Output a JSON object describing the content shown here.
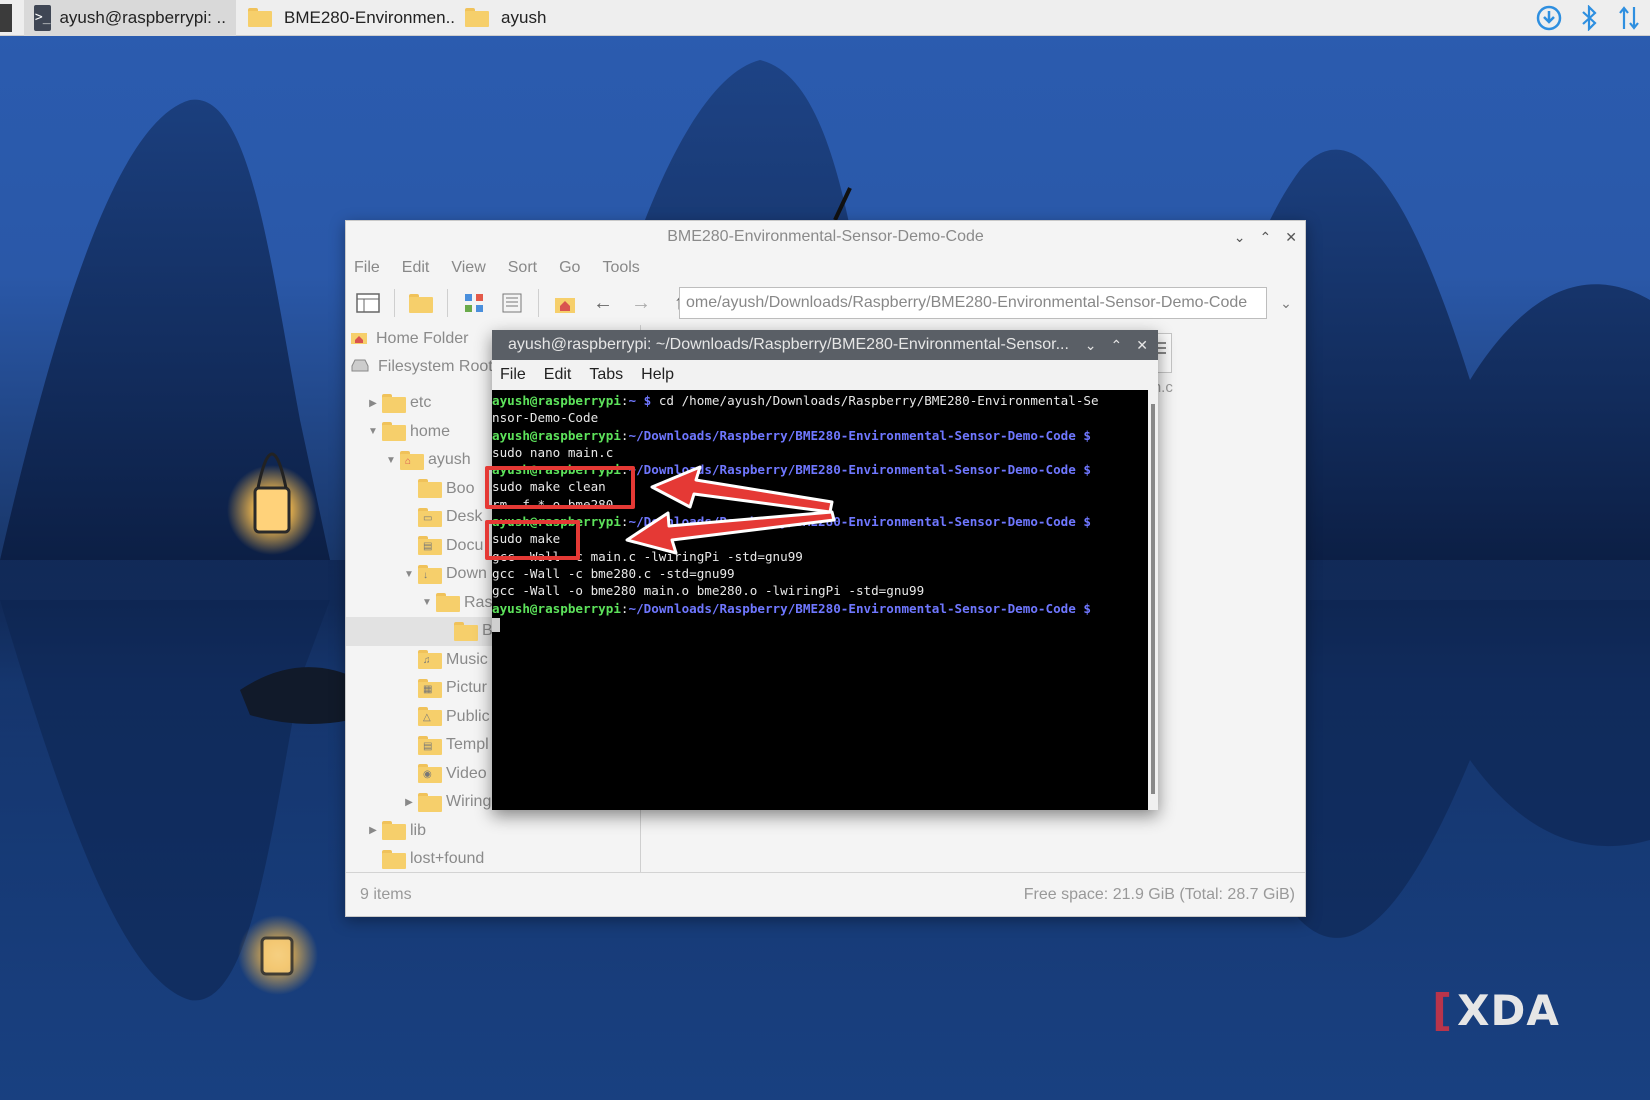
{
  "taskbar": {
    "items": [
      {
        "label": "ayush@raspberrypi: ..",
        "icon": "terminal-icon",
        "active": true
      },
      {
        "label": "BME280-Environmen..",
        "icon": "folder-icon",
        "active": false
      },
      {
        "label": "ayush",
        "icon": "folder-icon",
        "active": false
      }
    ],
    "tray": [
      "download-icon",
      "bluetooth-icon",
      "network-transfer-icon"
    ]
  },
  "file_manager": {
    "title": "BME280-Environmental-Sensor-Demo-Code",
    "menu": [
      "File",
      "Edit",
      "View",
      "Sort",
      "Go",
      "Tools"
    ],
    "path": "ome/ayush/Downloads/Raspberry/BME280-Environmental-Sensor-Demo-Code",
    "places": [
      {
        "label": "Home Folder",
        "icon": "home-icon"
      },
      {
        "label": "Filesystem Root",
        "icon": "drive-icon"
      }
    ],
    "tree": [
      {
        "label": "etc",
        "indent": 0,
        "arrow": "right"
      },
      {
        "label": "home",
        "indent": 0,
        "arrow": "down"
      },
      {
        "label": "ayush",
        "indent": 1,
        "arrow": "down"
      },
      {
        "label": "Boo",
        "indent": 2,
        "arrow": ""
      },
      {
        "label": "Desk",
        "indent": 2,
        "arrow": ""
      },
      {
        "label": "Docu",
        "indent": 2,
        "arrow": ""
      },
      {
        "label": "Down",
        "indent": 2,
        "arrow": "down"
      },
      {
        "label": "Ras",
        "indent": 3,
        "arrow": "down"
      },
      {
        "label": "B",
        "indent": 4,
        "arrow": "",
        "selected": true
      },
      {
        "label": "Music",
        "indent": 2,
        "arrow": ""
      },
      {
        "label": "Pictur",
        "indent": 2,
        "arrow": ""
      },
      {
        "label": "Public",
        "indent": 2,
        "arrow": ""
      },
      {
        "label": "Templ",
        "indent": 2,
        "arrow": ""
      },
      {
        "label": "Video",
        "indent": 2,
        "arrow": ""
      },
      {
        "label": "Wiring",
        "indent": 2,
        "arrow": "right"
      },
      {
        "label": "lib",
        "indent": 0,
        "arrow": "right"
      },
      {
        "label": "lost+found",
        "indent": 0,
        "arrow": ""
      }
    ],
    "file_label": "ain.c",
    "status_left": "9 items",
    "status_right": "Free space: 21.9 GiB (Total: 28.7 GiB)"
  },
  "terminal": {
    "title": "ayush@raspberrypi: ~/Downloads/Raspberry/BME280-Environmental-Sensor...",
    "menu": [
      "File",
      "Edit",
      "Tabs",
      "Help"
    ],
    "lines": [
      [
        {
          "c": "p-user",
          "t": "ayush@raspberrypi"
        },
        {
          "c": "",
          "t": ":"
        },
        {
          "c": "p-path",
          "t": "~ $"
        },
        {
          "c": "",
          "t": " cd /home/ayush/Downloads/Raspberry/BME280-Environmental-Se"
        }
      ],
      [
        {
          "c": "",
          "t": "nsor-Demo-Code"
        }
      ],
      [
        {
          "c": "p-user",
          "t": "ayush@raspberrypi"
        },
        {
          "c": "",
          "t": ":"
        },
        {
          "c": "p-path",
          "t": "~/Downloads/Raspberry/BME280-Environmental-Sensor-Demo-Code $"
        }
      ],
      [
        {
          "c": "",
          "t": "sudo nano main.c"
        }
      ],
      [
        {
          "c": "p-user",
          "t": "ayush@raspberrypi"
        },
        {
          "c": "",
          "t": ":"
        },
        {
          "c": "p-path",
          "t": "~/Downloads/Raspberry/BME280-Environmental-Sensor-Demo-Code $"
        }
      ],
      [
        {
          "c": "",
          "t": "sudo make clean"
        }
      ],
      [
        {
          "c": "",
          "t": "rm -f *.o bme280"
        }
      ],
      [
        {
          "c": "p-user",
          "t": "ayush@raspberrypi"
        },
        {
          "c": "",
          "t": ":"
        },
        {
          "c": "p-path",
          "t": "~/Downloads/Raspberry/BME280-Environmental-Sensor-Demo-Code $"
        }
      ],
      [
        {
          "c": "",
          "t": "sudo make"
        }
      ],
      [
        {
          "c": "",
          "t": "gcc -Wall -c main.c -lwiringPi -std=gnu99"
        }
      ],
      [
        {
          "c": "",
          "t": "gcc -Wall -c bme280.c -std=gnu99"
        }
      ],
      [
        {
          "c": "",
          "t": "gcc -Wall -o bme280 main.o bme280.o -lwiringPi -std=gnu99"
        }
      ],
      [
        {
          "c": "p-user",
          "t": "ayush@raspberrypi"
        },
        {
          "c": "",
          "t": ":"
        },
        {
          "c": "p-path",
          "t": "~/Downloads/Raspberry/BME280-Environmental-Sensor-Demo-Code $"
        }
      ]
    ]
  },
  "annotations": [
    "sudo make clean",
    "sudo make"
  ],
  "watermark": "XDA",
  "colors": {
    "accent_red": "#e53935",
    "prompt_user": "#5de35b",
    "prompt_path": "#6f77ff"
  }
}
